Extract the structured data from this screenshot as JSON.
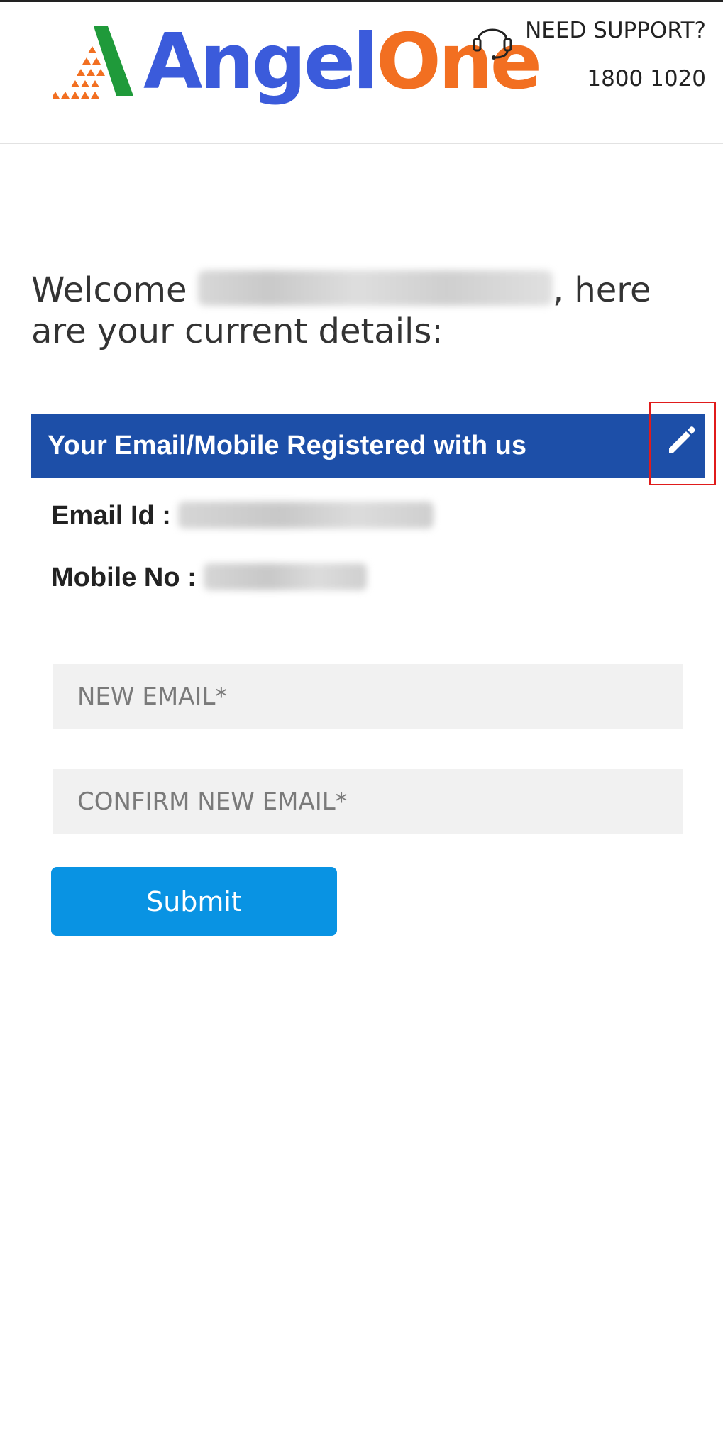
{
  "brand": {
    "logo_part1": "Angel",
    "logo_part2": "One",
    "colors": {
      "blue": "#3b5bdb",
      "orange": "#f26f21",
      "green": "#1f9a3a"
    }
  },
  "support": {
    "icon": "headset-icon",
    "title": "NEED SUPPORT?",
    "phone": "1800 1020"
  },
  "welcome": {
    "prefix": "Welcome",
    "suffix": ", here are your current details:"
  },
  "registered": {
    "title": "Your Email/Mobile Registered with us",
    "edit_icon": "pencil-icon",
    "email_label": "Email Id :",
    "mobile_label": "Mobile No :",
    "banner_color": "#1d4fa8"
  },
  "form": {
    "new_email_placeholder": "NEW EMAIL*",
    "confirm_email_placeholder": "CONFIRM NEW EMAIL*",
    "submit_label": "Submit",
    "submit_color": "#0993e3"
  }
}
